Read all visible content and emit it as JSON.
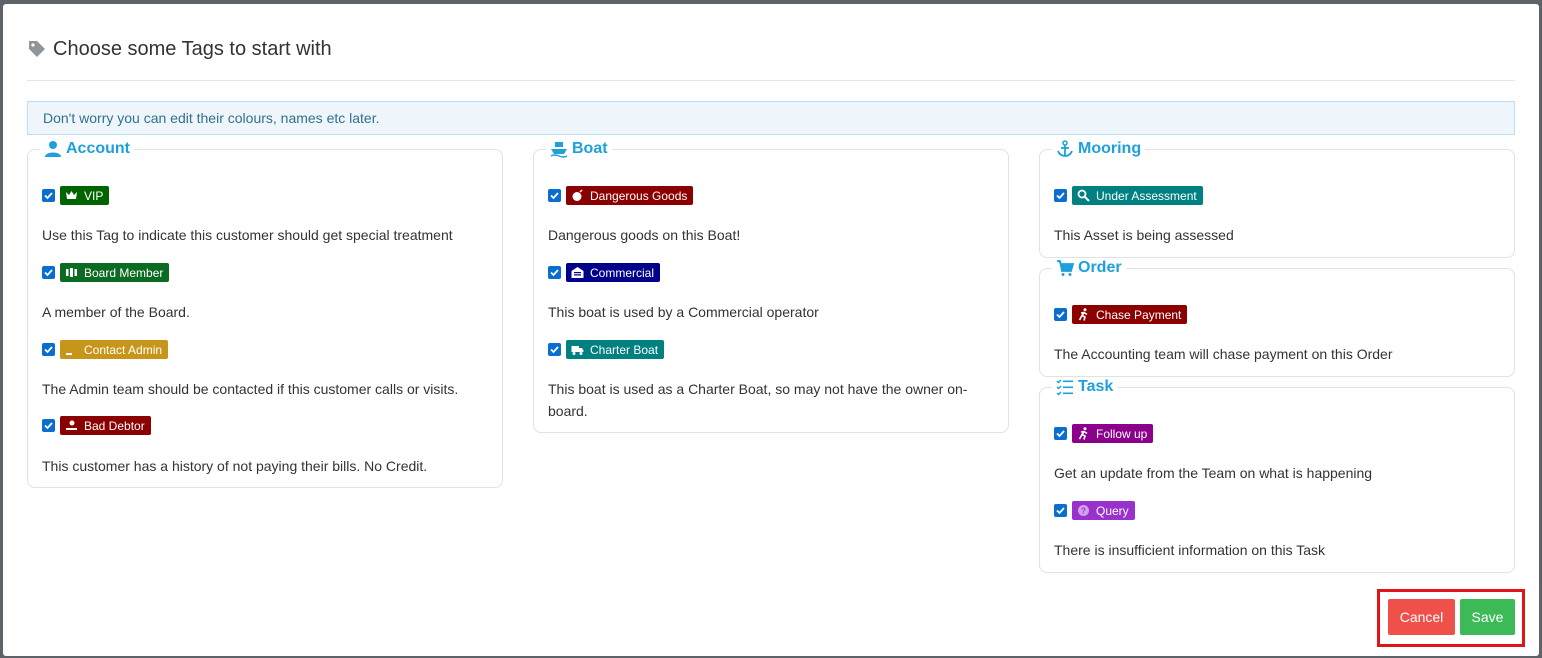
{
  "dialog": {
    "title": "Choose some Tags to start with",
    "info": "Don't worry you can edit their colours, names etc later."
  },
  "groups": {
    "account": {
      "title": "Account",
      "tags": [
        {
          "label": "VIP",
          "color": "#006400",
          "icon": "crown-icon",
          "checked": true,
          "description": "Use this Tag to indicate this customer should get special treatment"
        },
        {
          "label": "Board Member",
          "color": "#0b6b22",
          "icon": "users-icon",
          "checked": true,
          "description": "A member of the Board."
        },
        {
          "label": "Contact Admin",
          "color": "#c7951a",
          "icon": "phone-icon",
          "checked": true,
          "description": "The Admin team should be contacted if this customer calls or visits."
        },
        {
          "label": "Bad Debtor",
          "color": "#8b0000",
          "icon": "hand-coin-icon",
          "checked": true,
          "description": "This customer has a history of not paying their bills. No Credit."
        }
      ]
    },
    "boat": {
      "title": "Boat",
      "tags": [
        {
          "label": "Dangerous Goods",
          "color": "#8b0000",
          "icon": "bomb-icon",
          "checked": true,
          "description": "Dangerous goods on this Boat!"
        },
        {
          "label": "Commercial",
          "color": "#00008b",
          "icon": "warehouse-icon",
          "checked": true,
          "description": "This boat is used by a Commercial operator"
        },
        {
          "label": "Charter Boat",
          "color": "#008080",
          "icon": "truck-icon",
          "checked": true,
          "description": "This boat is used as a Charter Boat, so may not have the owner on-board."
        }
      ]
    },
    "mooring": {
      "title": "Mooring",
      "tags": [
        {
          "label": "Under Assessment",
          "color": "#008080",
          "icon": "search-icon",
          "checked": true,
          "description": "This Asset is being assessed"
        }
      ]
    },
    "order": {
      "title": "Order",
      "tags": [
        {
          "label": "Chase Payment",
          "color": "#8b0000",
          "icon": "running-icon",
          "checked": true,
          "description": "The Accounting team will chase payment on this Order"
        }
      ]
    },
    "task": {
      "title": "Task",
      "tags": [
        {
          "label": "Follow up",
          "color": "#8b008b",
          "icon": "running-icon",
          "checked": true,
          "description": "Get an update from the Team on what is happening"
        },
        {
          "label": "Query",
          "color": "#9932cc",
          "icon": "question-circle-icon",
          "checked": true,
          "description": "There is insufficient information on this Task"
        }
      ]
    }
  },
  "buttons": {
    "cancel": "Cancel",
    "save": "Save"
  },
  "colors": {
    "accent": "#1ea0dc",
    "cancel": "#f0504a",
    "save": "#3dba58",
    "highlight_frame": "#e0151a"
  }
}
